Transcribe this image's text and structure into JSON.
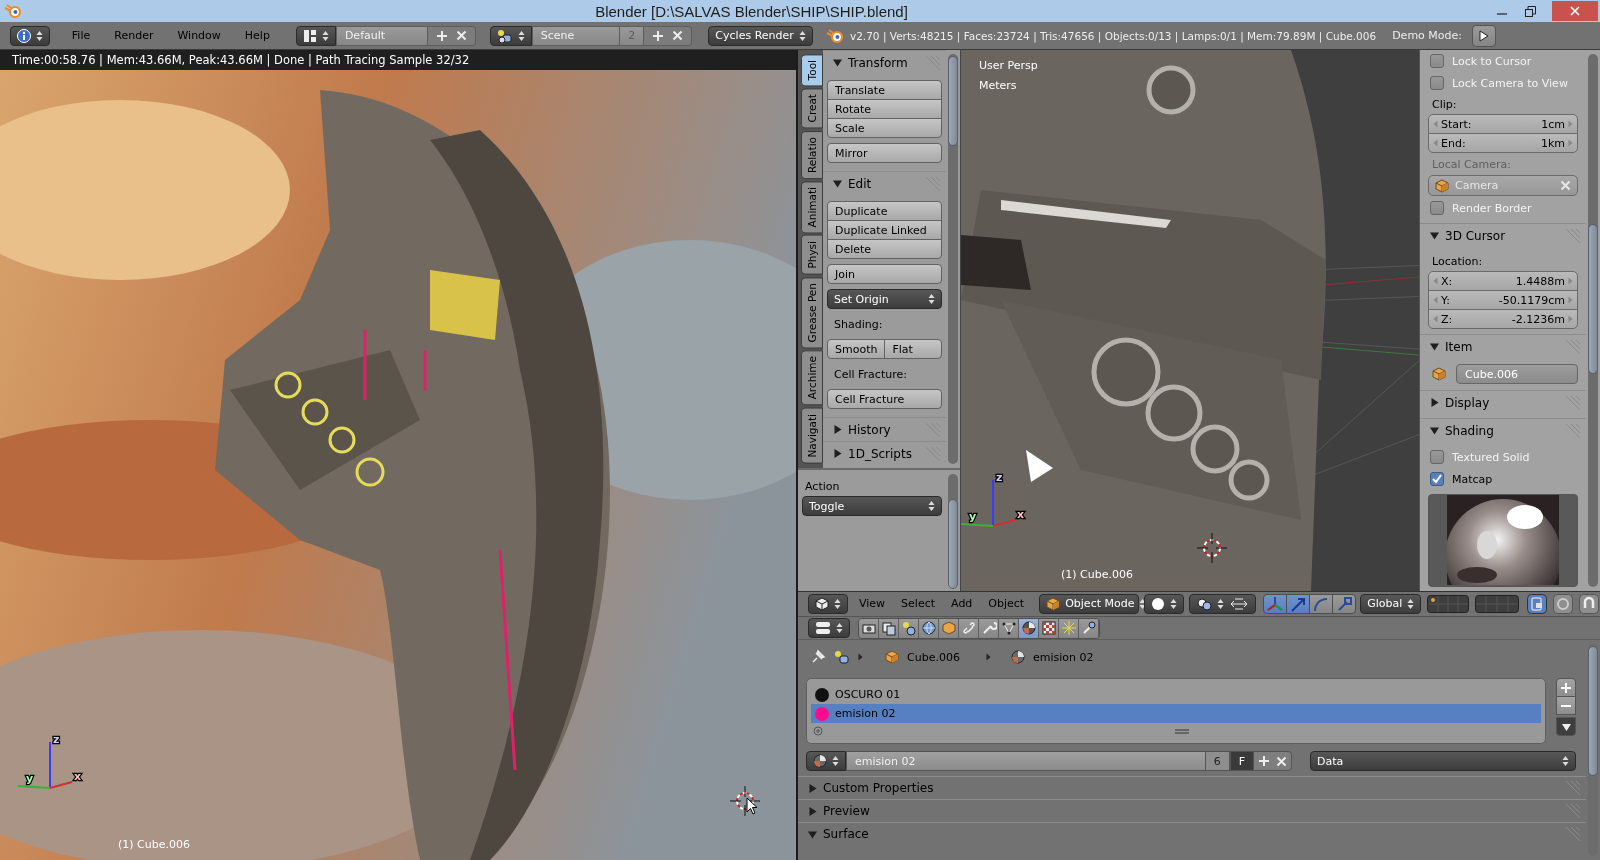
{
  "window": {
    "title": "Blender [D:\\SALVAS Blender\\SHIP\\SHIP.blend]"
  },
  "info_header": {
    "menus": [
      "File",
      "Render",
      "Window",
      "Help"
    ],
    "screen_layout": "Default",
    "scene": "Scene",
    "scene_users": "2",
    "render_engine": "Cycles Render",
    "stats": "v2.70 | Verts:48215 | Faces:23724 | Tris:47656 | Objects:0/13 | Lamps:0/1 | Mem:79.89M | Cube.006",
    "demo_mode": "Demo Mode:"
  },
  "render_view": {
    "status": "Time:00:58.76 | Mem:43.66M, Peak:43.66M | Done | Path Tracing Sample 32/32",
    "object_label": "(1) Cube.006",
    "axes": [
      "z",
      "y",
      "x"
    ]
  },
  "tool_shelf": {
    "tabs": [
      {
        "label": "Tool",
        "selected": true
      },
      {
        "label": "Creat",
        "selected": false
      },
      {
        "label": "Relatio",
        "selected": false
      },
      {
        "label": "Animati",
        "selected": false
      },
      {
        "label": "Physi",
        "selected": false
      },
      {
        "label": "Grease Pen",
        "selected": false
      },
      {
        "label": "Archime",
        "selected": false
      },
      {
        "label": "Navigati",
        "selected": false
      }
    ],
    "panels": [
      {
        "title": "Transform",
        "expanded": true,
        "items": [
          {
            "kind": "stack",
            "buttons": [
              "Translate",
              "Rotate",
              "Scale"
            ]
          },
          {
            "kind": "stack",
            "buttons": [
              "Mirror"
            ]
          }
        ]
      },
      {
        "title": "Edit",
        "expanded": true,
        "items": [
          {
            "kind": "stack",
            "buttons": [
              "Duplicate",
              "Duplicate Linked",
              "Delete"
            ]
          },
          {
            "kind": "stack",
            "buttons": [
              "Join"
            ]
          },
          {
            "kind": "menu",
            "value": "Set Origin"
          },
          {
            "kind": "label",
            "text": "Shading:"
          },
          {
            "kind": "row",
            "buttons": [
              "Smooth",
              "Flat"
            ]
          },
          {
            "kind": "label",
            "text": "Cell Fracture:"
          },
          {
            "kind": "stack",
            "buttons": [
              "Cell Fracture"
            ]
          }
        ]
      },
      {
        "title": "History",
        "expanded": false
      },
      {
        "title": "1D_Scripts",
        "expanded": false
      }
    ],
    "operator": {
      "label": "Action",
      "value": "Toggle"
    }
  },
  "viewport": {
    "view_name": "User Persp",
    "units": "Meters",
    "object_label": "(1) Cube.006",
    "axes": [
      "z",
      "y",
      "x"
    ]
  },
  "properties_region": {
    "items": [
      {
        "kind": "checkbox",
        "label": "Lock to Cursor",
        "checked": false
      },
      {
        "kind": "checkbox",
        "label": "Lock Camera to View",
        "checked": false
      },
      {
        "kind": "label",
        "text": "Clip:",
        "disabled": false
      },
      {
        "kind": "numbers",
        "fields": [
          {
            "label": "Start:",
            "value": "1cm"
          },
          {
            "label": "End:",
            "value": "1km"
          }
        ]
      },
      {
        "kind": "label",
        "text": "Local Camera:",
        "disabled": true
      },
      {
        "kind": "object",
        "value": "Camera",
        "disabled": true
      },
      {
        "kind": "checkbox",
        "label": "Render Border",
        "checked": false
      },
      {
        "kind": "panel",
        "title": "3D Cursor",
        "expanded": true
      },
      {
        "kind": "label",
        "text": "Location:",
        "disabled": false
      },
      {
        "kind": "numbers",
        "fields": [
          {
            "label": "X:",
            "value": "1.4488m"
          },
          {
            "label": "Y:",
            "value": "-50.1179cm"
          },
          {
            "label": "Z:",
            "value": "-2.1236m"
          }
        ]
      },
      {
        "kind": "panel",
        "title": "Item",
        "expanded": true
      },
      {
        "kind": "name",
        "value": "Cube.006"
      },
      {
        "kind": "panel",
        "title": "Display",
        "expanded": false
      },
      {
        "kind": "panel",
        "title": "Shading",
        "expanded": true
      },
      {
        "kind": "checkbox",
        "label": "Textured Solid",
        "checked": false
      },
      {
        "kind": "checkbox",
        "label": "Matcap",
        "checked": true
      },
      {
        "kind": "matcap"
      }
    ]
  },
  "view_header": {
    "menus": [
      "View",
      "Select",
      "Add",
      "Object"
    ],
    "mode": "Object Mode",
    "manipulators": [
      {
        "on": true
      },
      {
        "on": true
      },
      {
        "on": false
      },
      {
        "on": false
      }
    ],
    "orientation": "Global"
  },
  "properties_editor": {
    "context_tabs": [
      {
        "selected": false
      },
      {
        "selected": false
      },
      {
        "selected": false
      },
      {
        "selected": false
      },
      {
        "selected": false
      },
      {
        "selected": false
      },
      {
        "selected": false
      },
      {
        "selected": false
      },
      {
        "selected": true
      },
      {
        "selected": false
      },
      {
        "selected": false
      },
      {
        "selected": false
      }
    ],
    "breadcrumb": [
      "Cube.006",
      "emision 02"
    ],
    "material_slots": [
      {
        "name": "OSCURO 01",
        "color": "#111111",
        "selected": false
      },
      {
        "name": "emision 02",
        "color": "#ff0a8c",
        "selected": true
      }
    ],
    "material": {
      "name": "emision 02",
      "users": "6",
      "fake_user": "F",
      "link": "Data"
    },
    "panels": [
      {
        "title": "Custom Properties",
        "expanded": false
      },
      {
        "title": "Preview",
        "expanded": false
      },
      {
        "title": "Surface",
        "expanded": true
      }
    ]
  }
}
